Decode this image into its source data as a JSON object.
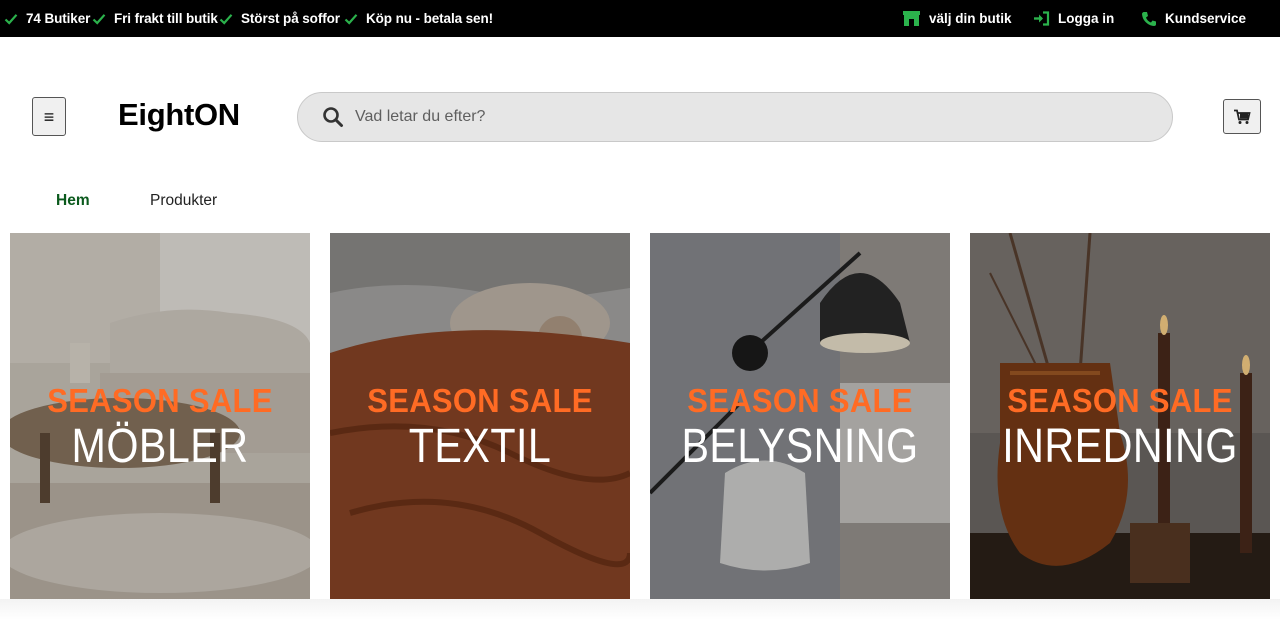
{
  "topbar": {
    "usps": [
      {
        "label": "74 Butiker"
      },
      {
        "label": "Fri frakt till butik"
      },
      {
        "label": "Störst på soffor"
      },
      {
        "label": "Köp nu - betala sen!"
      }
    ],
    "links": {
      "store": "välj din butik",
      "login": "Logga in",
      "service": "Kundservice"
    }
  },
  "header": {
    "logo": "EightON",
    "search_placeholder": "Vad letar du efter?",
    "menu_icon": "≡"
  },
  "nav": {
    "home": "Hem",
    "products": "Produkter"
  },
  "tiles": [
    {
      "sale": "SEASON SALE",
      "category": "MÖBLER"
    },
    {
      "sale": "SEASON SALE",
      "category": "TEXTIL"
    },
    {
      "sale": "SEASON SALE",
      "category": "BELYSNING"
    },
    {
      "sale": "SEASON SALE",
      "category": "INREDNING"
    }
  ],
  "colors": {
    "accent_green": "#2bb24c",
    "nav_active": "#0b5a1d",
    "sale_orange": "#ff6b24"
  },
  "icons": [
    "check-icon",
    "store-icon",
    "login-icon",
    "phone-icon",
    "menu-icon",
    "search-icon",
    "cart-icon"
  ]
}
